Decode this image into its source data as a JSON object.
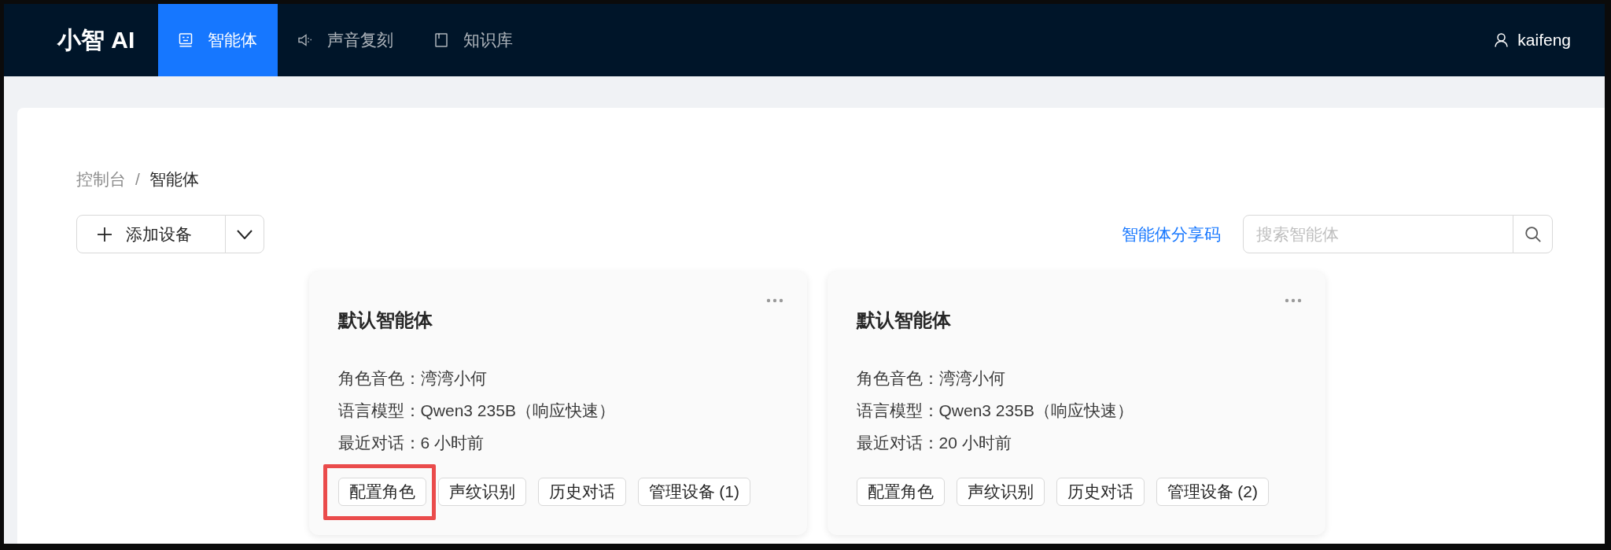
{
  "nav": {
    "logo": "小智 AI",
    "tabs": [
      {
        "label": "智能体",
        "selected": true
      },
      {
        "label": "声音复刻",
        "selected": false
      },
      {
        "label": "知识库",
        "selected": false
      }
    ],
    "user": "kaifeng"
  },
  "breadcrumb": {
    "items": [
      {
        "label": "控制台",
        "current": false
      },
      {
        "label": "智能体",
        "current": true
      }
    ],
    "separator": "/"
  },
  "toolbar": {
    "add_button": "添加设备",
    "share_link": "智能体分享码",
    "search": {
      "placeholder": "搜索智能体"
    }
  },
  "agents": [
    {
      "name": "默认智能体",
      "details": [
        "角色音色：湾湾小何",
        "语言模型：Qwen3 235B（响应快速）",
        "最近对话：6 小时前"
      ],
      "actions": [
        {
          "label": "配置角色",
          "highlighted": true
        },
        {
          "label": "声纹识别",
          "highlighted": false
        },
        {
          "label": "历史对话",
          "highlighted": false
        },
        {
          "label": "管理设备 (1)",
          "highlighted": false
        }
      ]
    },
    {
      "name": "默认智能体",
      "details": [
        "角色音色：湾湾小何",
        "语言模型：Qwen3 235B（响应快速）",
        "最近对话：20 小时前"
      ],
      "actions": [
        {
          "label": "配置角色",
          "highlighted": false
        },
        {
          "label": "声纹识别",
          "highlighted": false
        },
        {
          "label": "历史对话",
          "highlighted": false
        },
        {
          "label": "管理设备 (2)",
          "highlighted": false
        }
      ]
    }
  ]
}
